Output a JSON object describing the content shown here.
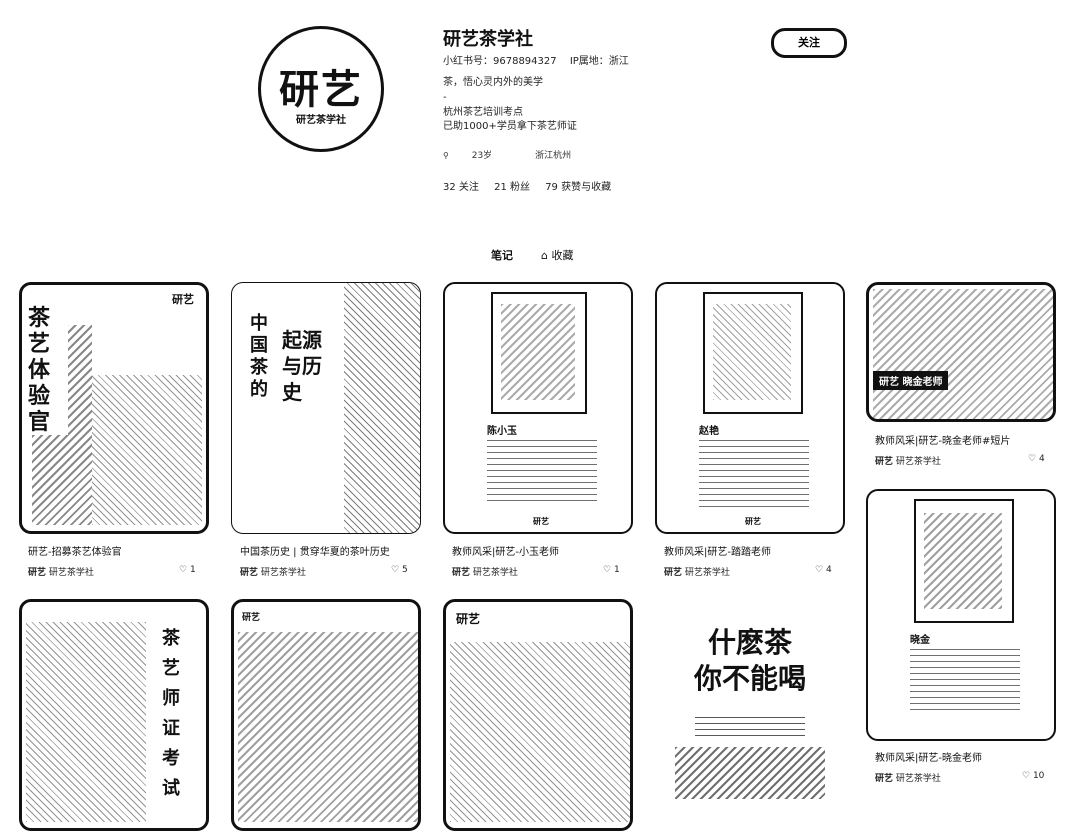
{
  "profile": {
    "avatar_text": "研艺",
    "avatar_sub": "研艺茶学社",
    "name": "研艺茶学社",
    "id_label": "小红书号：9678894327",
    "ip_label": "IP属地：浙江",
    "bio_line1": "茶，悟心灵内外的美学",
    "bio_line2": "-",
    "bio_line3": "杭州茶艺培训考点",
    "bio_line4": "已助1000+学员拿下茶艺师证",
    "age_tag": "23岁",
    "location_tag": "浙江杭州",
    "following": "32 关注",
    "followers": "21 粉丝",
    "likes_collects": "79 获赞与收藏",
    "follow_button": "关注"
  },
  "tabs": {
    "notes": "笔记",
    "collections": "收藏"
  },
  "notes": [
    {
      "caption": "研艺-招募茶艺体验官",
      "author": "研艺茶学社",
      "likes": "1",
      "cover_text": "茶艺体验官",
      "cover_logo": "研艺"
    },
    {
      "caption": "中国茶历史 | 贯穿华夏的茶叶历史",
      "author": "研艺茶学社",
      "likes": "5",
      "cover_text_a": "中国茶的",
      "cover_text_b": "起源与历史"
    },
    {
      "caption": "教师风采|研艺-小玉老师",
      "author": "研艺茶学社",
      "likes": "1",
      "cover_name": "陈小玉",
      "cover_logo": "研艺"
    },
    {
      "caption": "教师风采|研艺-踏踏老师",
      "author": "研艺茶学社",
      "likes": "4",
      "cover_name": "赵艳",
      "cover_logo": "研艺"
    },
    {
      "caption": "教师风采|研艺-晓金老师#短片",
      "author": "研艺茶学社",
      "likes": "4",
      "cover_banner": "研艺 晓金老师"
    },
    {
      "caption": "教师风采|研艺-晓金老师",
      "author": "研艺茶学社",
      "likes": "10",
      "cover_name": "晓金",
      "cover_logo": "研艺"
    },
    {
      "cover_text": "茶艺师证考试"
    },
    {
      "cover_logo": "研艺"
    },
    {
      "cover_logo": "研艺"
    },
    {
      "cover_line1": "什麽茶",
      "cover_line2": "你不能喝"
    }
  ],
  "colors": {
    "ink": "#111111",
    "paper": "#ffffff"
  },
  "icons": {
    "location": "pin-icon",
    "heart": "heart-icon",
    "collection": "lock-icon"
  }
}
